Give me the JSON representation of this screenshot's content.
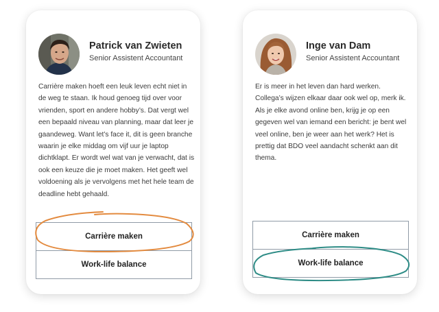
{
  "cards": [
    {
      "name": "Patrick van Zwieten",
      "role": "Senior Assistent Accountant",
      "text": "Carrière maken hoeft een leuk leven echt niet in de weg te staan. Ik houd genoeg tijd over voor vrienden, sport en andere hobby’s. Dat vergt wel een bepaald niveau van planning, maar dat leer je gaandeweg. Want let’s face it, dit is geen branche waarin je elke middag om vijf uur je laptop dichtklapt. Er wordt wel wat van je verwacht, dat is ook een keuze die je moet maken. Het geeft wel voldoening als je vervolgens met het hele team de deadline hebt gehaald.",
      "options": [
        "Carrière maken",
        "Work-life balance"
      ],
      "circled_option": "Carrière maken",
      "circle_color": "#e38a3e"
    },
    {
      "name": "Inge van Dam",
      "role": "Senior Assistent Accountant",
      "text": "Er is meer in het leven dan hard werken. Collega’s wijzen elkaar daar ook wel op, merk ik. Als je elke avond online ben, krijg je op een gegeven wel van iemand een bericht: je bent wel veel online, ben je weer aan het werk? Het is prettig dat BDO veel aandacht schenkt aan dit thema.",
      "options": [
        "Carrière maken",
        "Work-life balance"
      ],
      "circled_option": "Work-life balance",
      "circle_color": "#2e8c86"
    }
  ]
}
